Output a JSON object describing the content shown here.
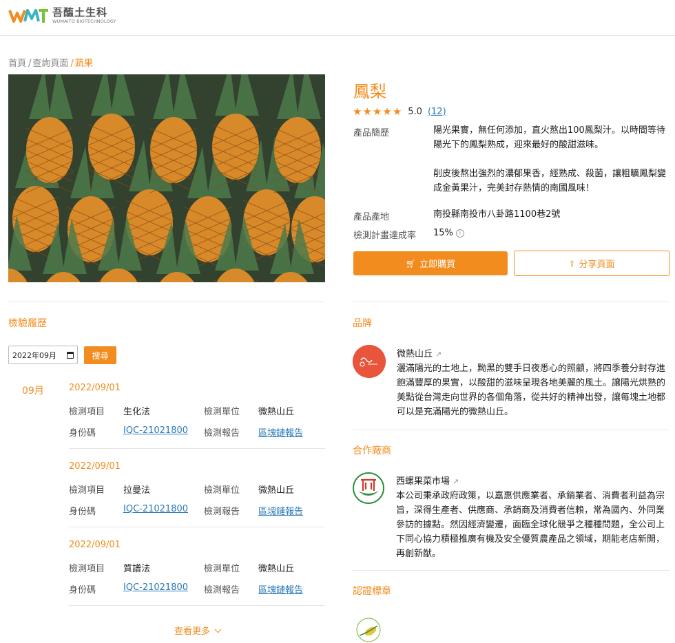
{
  "header": {
    "logo_cn": "吾醢土生科",
    "logo_en": "WUMAITO BIOTECHNOLOGY",
    "colors": {
      "brand_orange": "#f28c1e",
      "brand_blue": "#2a7ab8"
    }
  },
  "breadcrumb": {
    "items": [
      "首頁",
      "查詢頁面",
      "蔬果"
    ],
    "separator": "/"
  },
  "product": {
    "title": "鳳梨",
    "rating": "5.0",
    "stars": 5,
    "review_count": "(12)",
    "labels": {
      "desc": "產品簡歷",
      "origin": "產品產地",
      "rate": "檢測計畫達成率"
    },
    "desc_p1": "陽光果實，無任何添加，直火熬出100鳳梨汁。以時間等待陽光下的鳳梨熟成，迎來最好的酸甜滋味。",
    "desc_p2": "削皮後熬出強烈的濃郁果香，經熟成、殺菌，讓粗曠鳳梨變成金黃果汁，完美封存熱情的南國風味！",
    "origin": "南投縣南投市八卦路1100巷2號",
    "rate": "15%",
    "buy_label": "立即購買",
    "share_label": "分享頁面"
  },
  "inspection": {
    "title": "檢驗履歷",
    "date_value": "2022年09月",
    "search_label": "搜尋",
    "month": "09月",
    "labels": {
      "item": "檢測項目",
      "unit": "檢測單位",
      "id": "身份碼",
      "report": "檢測報告"
    },
    "records": [
      {
        "date": "2022/09/01",
        "item": "生化法",
        "unit": "微熱山丘",
        "id": "IQC-21021800",
        "report": "區塊鏈報告"
      },
      {
        "date": "2022/09/01",
        "item": "拉曼法",
        "unit": "微熱山丘",
        "id": "IQC-21021800",
        "report": "區塊鏈報告"
      },
      {
        "date": "2022/09/01",
        "item": "質譜法",
        "unit": "微熱山丘",
        "id": "IQC-21021800",
        "report": "區塊鏈報告"
      }
    ],
    "more_label": "查看更多"
  },
  "brand": {
    "title": "品牌",
    "name": "微熱山丘",
    "desc": "灑滿陽光的土地上，黝黑的雙手日夜悉心的照顧，將四季養分封存進飽滿豐厚的果實，以酸甜的滋味呈現各地美麗的風土。讓陽光烘熟的美點從台灣走向世界的各個角落，從共好的精神出發，讓每塊土地都可以是充滿陽光的微熱山丘。"
  },
  "partner": {
    "title": "合作廠商",
    "name": "西螺果菜市場",
    "desc": "本公司秉承政府政策，以嘉惠供應業者、承銷業者、消費者利益為宗旨，深得生產者、供應商、承銷商及消費者信賴，常為國內、外同業參訪的據點。然因經濟變遷，面臨全球化競爭之種種問題，全公司上下同心協力積極推廣有機及安全優質農產品之領域，期能老店新開，再創新猷。"
  },
  "certification": {
    "title": "認證標章"
  }
}
